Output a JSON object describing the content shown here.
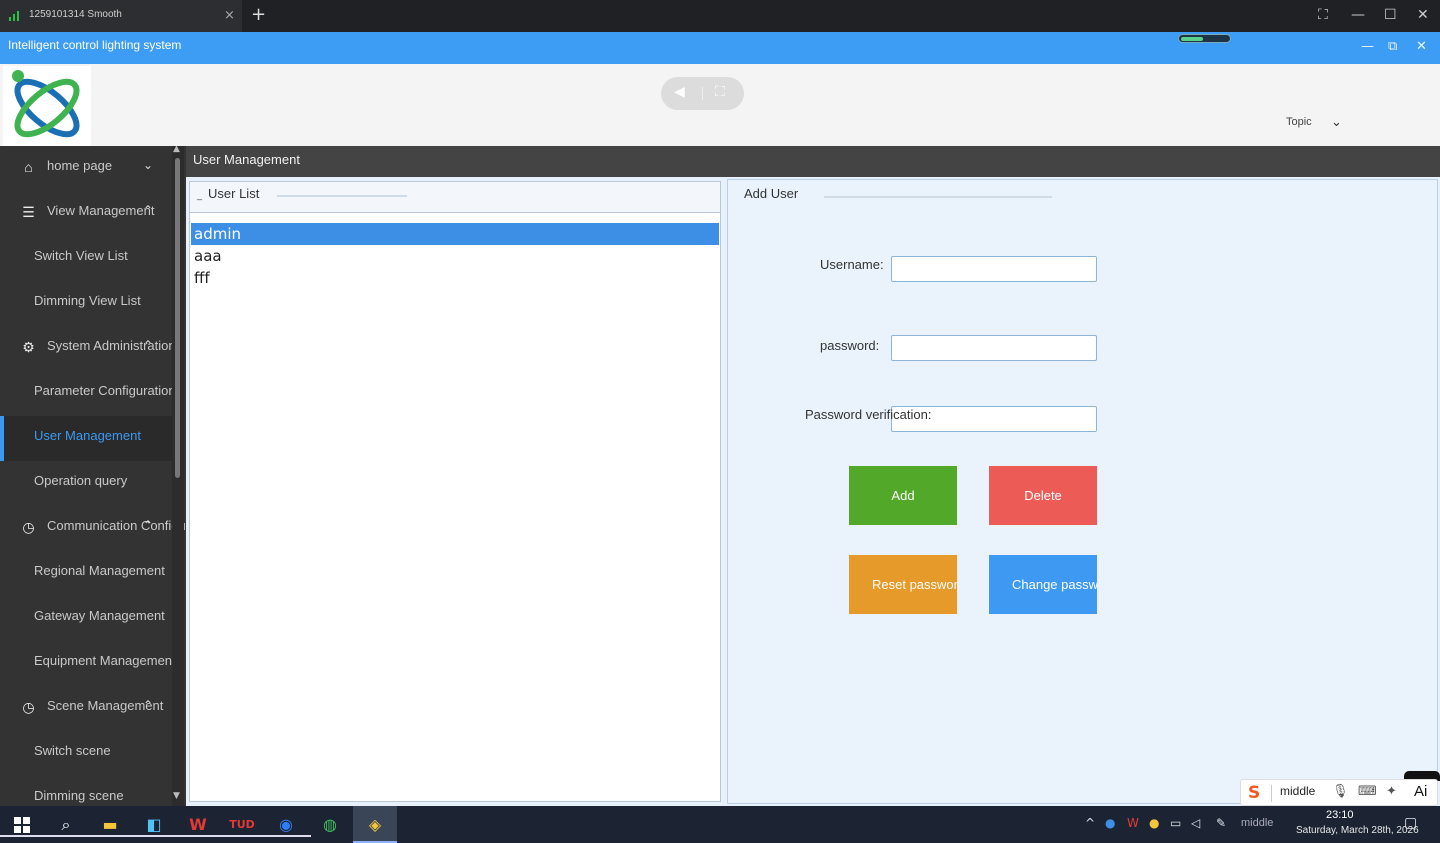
{
  "remote_session": {
    "tab_title": "1259101314 Smooth",
    "tab_close": "×",
    "new_tab": "+",
    "controls": [
      "⛶",
      "—",
      "☐",
      "✕"
    ]
  },
  "app": {
    "title": "Intelligent control lighting system",
    "window_controls": [
      "—",
      "⧉",
      "✕"
    ]
  },
  "header": {
    "topic_label": "Topic",
    "topic_chevron": "⌄",
    "media_buttons": [
      "◀",
      "⛶"
    ]
  },
  "sidebar": {
    "items": [
      {
        "label": "home page",
        "type": "parent",
        "icon": "home-icon",
        "glyph": "⌂",
        "chevron": "⌄"
      },
      {
        "label": "View Management",
        "type": "parent",
        "icon": "list-icon",
        "glyph": "☰",
        "chevron": "⌃"
      },
      {
        "label": "Switch View List",
        "type": "child"
      },
      {
        "label": "Dimming View List",
        "type": "child"
      },
      {
        "label": "System Administration",
        "type": "parent",
        "icon": "gear-icon",
        "glyph": "⚙",
        "chevron": "⌃"
      },
      {
        "label": "Parameter Configuration",
        "type": "child"
      },
      {
        "label": "User Management",
        "type": "child",
        "active": true
      },
      {
        "label": "Operation query",
        "type": "child"
      },
      {
        "label": "Communication Configuration",
        "type": "parent",
        "icon": "clock-icon",
        "glyph": "◷",
        "chevron": "⌃"
      },
      {
        "label": "Regional Management",
        "type": "child"
      },
      {
        "label": "Gateway Management",
        "type": "child"
      },
      {
        "label": "Equipment Management",
        "type": "child"
      },
      {
        "label": "Scene Management",
        "type": "parent",
        "icon": "clock-icon",
        "glyph": "◷",
        "chevron": "⌃"
      },
      {
        "label": "Switch scene",
        "type": "child"
      },
      {
        "label": "Dimming scene",
        "type": "child"
      }
    ]
  },
  "content": {
    "title": "User Management",
    "user_list": {
      "collapse": "_",
      "title": "User List",
      "users": [
        "admin",
        "aaa",
        "fff"
      ],
      "selected": "admin"
    },
    "add_user": {
      "title": "Add User",
      "username_label": "Username:",
      "username_value": "",
      "password_label": "password:",
      "password_value": "",
      "verify_label": "Password verification:",
      "verify_value": "",
      "add_button": "Add",
      "delete_button": "Delete",
      "reset_button": "Reset password",
      "change_button": "Change password"
    }
  },
  "ime": {
    "logo": "S",
    "mode": "middle",
    "ai_label": "Ai"
  },
  "taskbar": {
    "tray_ime": "middle",
    "time": "23:10",
    "date": "Saturday, March 28th, 2026",
    "accent": "#8ab4f8"
  }
}
